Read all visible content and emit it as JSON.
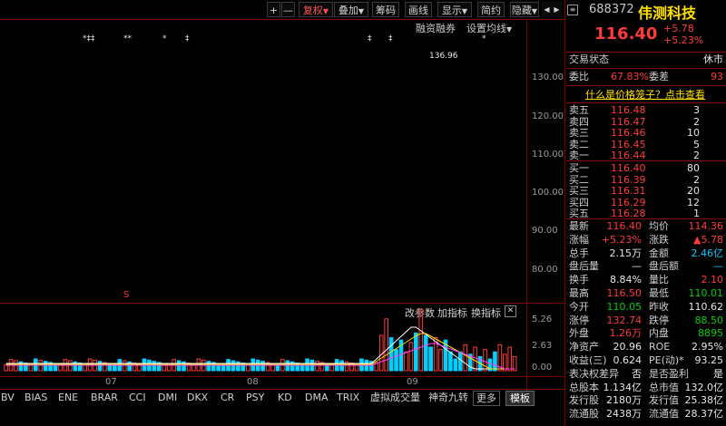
{
  "toolbar": {
    "plus": "+",
    "minus": "—",
    "fuquan": "复权",
    "diejia": "叠加",
    "chouma": "筹码",
    "huaxian": "画线",
    "xianshi": "显示",
    "jianyue": "简约",
    "yincang": "隐藏",
    "nav_prev": "◀",
    "nav_next": "▶"
  },
  "chart": {
    "rzrq": "融资融券",
    "jundian": "设置均线",
    "peak_label": "136.96",
    "y_labels": [
      "130.00",
      "120.00",
      "110.00",
      "100.00",
      "90.00",
      "80.00"
    ],
    "sub_labels": [
      "5.26",
      "2.63",
      "0.00"
    ],
    "sub_tools": {
      "change_param": "改参数",
      "add_indicator": "加指标",
      "switch_indicator": "换指标",
      "close": "✕"
    },
    "month_labels": [
      "07",
      "08",
      "09"
    ],
    "event_marks": [
      "*‡‡",
      "**",
      "*",
      "‡",
      "‡",
      "‡",
      "*"
    ],
    "s_mark": "S"
  },
  "bottom_tabs": [
    "BV",
    "BIAS",
    "ENE",
    "BRAR",
    "CCI",
    "DMI",
    "DKX",
    "CR",
    "PSY",
    "KD",
    "DMA",
    "TRIX",
    "虚拟成交量",
    "神奇九转"
  ],
  "bottom_more": "更多",
  "bottom_template": "模板",
  "stock": {
    "code": "688372",
    "name": "伟测科技",
    "price": "116.40",
    "change": "+5.78",
    "change_pct": "+5.23%",
    "status_label": "交易状态",
    "status": "休市",
    "weibi_label": "委比",
    "weibi": "67.83%",
    "weicha_label": "委差",
    "weicha": "93",
    "tip": "什么是价格笼子？点击查看"
  },
  "sell": [
    {
      "label": "卖五",
      "price": "116.48",
      "vol": "3"
    },
    {
      "label": "卖四",
      "price": "116.47",
      "vol": "2"
    },
    {
      "label": "卖三",
      "price": "116.46",
      "vol": "10"
    },
    {
      "label": "卖二",
      "price": "116.45",
      "vol": "5"
    },
    {
      "label": "卖一",
      "price": "116.44",
      "vol": "2"
    }
  ],
  "buy": [
    {
      "label": "买一",
      "price": "116.40",
      "vol": "80"
    },
    {
      "label": "买二",
      "price": "116.39",
      "vol": "2"
    },
    {
      "label": "买三",
      "price": "116.31",
      "vol": "20"
    },
    {
      "label": "买四",
      "price": "116.29",
      "vol": "12"
    },
    {
      "label": "买五",
      "price": "116.28",
      "vol": "1"
    }
  ],
  "stats": [
    {
      "l1": "最新",
      "v1": "116.40",
      "c1": "red",
      "l2": "均价",
      "v2": "114.36",
      "c2": "red"
    },
    {
      "l1": "涨幅",
      "v1": "+5.23%",
      "c1": "red",
      "l2": "涨跌",
      "v2": "▲5.78",
      "c2": "red"
    },
    {
      "l1": "总手",
      "v1": "2.15万",
      "c1": "white",
      "l2": "金额",
      "v2": "2.46亿",
      "c2": "cyan"
    },
    {
      "l1": "盘后量",
      "v1": "—",
      "c1": "white",
      "l2": "盘后额",
      "v2": "—",
      "c2": "cyan"
    },
    {
      "l1": "换手",
      "v1": "8.84%",
      "c1": "white",
      "l2": "量比",
      "v2": "2.10",
      "c2": "red"
    },
    {
      "l1": "最高",
      "v1": "116.50",
      "c1": "red",
      "l2": "最低",
      "v2": "110.01",
      "c2": "green"
    },
    {
      "l1": "今开",
      "v1": "110.05",
      "c1": "green",
      "l2": "昨收",
      "v2": "110.62",
      "c2": "white"
    },
    {
      "l1": "涨停",
      "v1": "132.74",
      "c1": "red",
      "l2": "跌停",
      "v2": "88.50",
      "c2": "green"
    },
    {
      "l1": "外盘",
      "v1": "1.26万",
      "c1": "red",
      "l2": "内盘",
      "v2": "8895",
      "c2": "green"
    },
    {
      "l1": "净资产",
      "v1": "20.96",
      "c1": "white",
      "l2": "ROE",
      "v2": "2.95%",
      "c2": "white"
    },
    {
      "l1": "收益(三)",
      "v1": "0.624",
      "c1": "white",
      "l2": "PE(动)*",
      "v2": "93.25",
      "c2": "white"
    },
    {
      "l1": "表决权差异",
      "v1": "否",
      "c1": "white",
      "l2": "是否盈利",
      "v2": "是",
      "c2": "white"
    },
    {
      "l1": "总股本",
      "v1": "1.134亿",
      "c1": "white",
      "l2": "总市值",
      "v2": "132.0亿",
      "c2": "white"
    },
    {
      "l1": "发行股",
      "v1": "2180万",
      "c1": "white",
      "l2": "发行值",
      "v2": "25.38亿",
      "c2": "white"
    },
    {
      "l1": "流通股",
      "v1": "2438万",
      "c1": "white",
      "l2": "流通值",
      "v2": "28.37亿",
      "c2": "white"
    }
  ],
  "colors": {
    "up": "#ff3a3a",
    "down": "#00d0ff",
    "border": "#7a0000"
  }
}
